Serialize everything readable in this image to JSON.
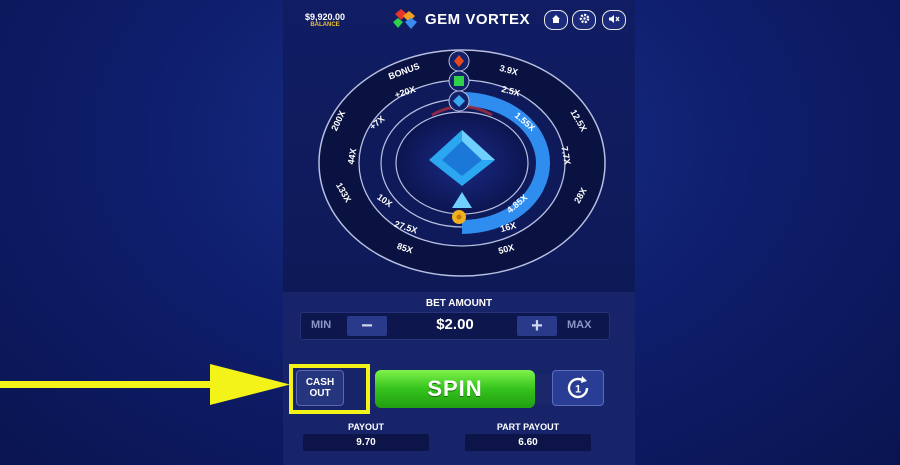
{
  "header": {
    "balance_value": "$9,920.00",
    "balance_label": "BALANCE",
    "title": "GEM VORTEX",
    "buttons": [
      "home-icon",
      "gear-icon",
      "mute-icon"
    ]
  },
  "wheel": {
    "outer_ring": [
      "BONUS",
      "3.9X",
      "12.5X",
      "7.7X",
      "28X",
      "50X",
      "85X",
      "133X",
      "44X",
      "200X"
    ],
    "middle_ring": [
      "+20X",
      "2.5X",
      "16X",
      "27.5X",
      "10X",
      "+7X"
    ],
    "inner_ring": [
      "1.55X",
      "4.85X"
    ],
    "pointers": [
      "red-gem-icon",
      "green-gem-icon",
      "blue-gem-icon"
    ],
    "coin": "coin-icon"
  },
  "bet": {
    "label": "BET AMOUNT",
    "min_label": "MIN",
    "max_label": "MAX",
    "minus": "−",
    "plus": "+",
    "value": "$2.00"
  },
  "actions": {
    "cash_out_line1": "CASH",
    "cash_out_line2": "OUT",
    "spin_label": "SPIN",
    "auto_value": "1"
  },
  "payouts": {
    "payout_label": "PAYOUT",
    "payout_value": "9.70",
    "part_payout_label": "PART PAYOUT",
    "part_payout_value": "6.60"
  },
  "colors": {
    "accent_green": "#35c31d",
    "highlight_yellow": "#f3f31a",
    "ring_blue": "#2f8df0",
    "background": "#0f1f6e"
  }
}
